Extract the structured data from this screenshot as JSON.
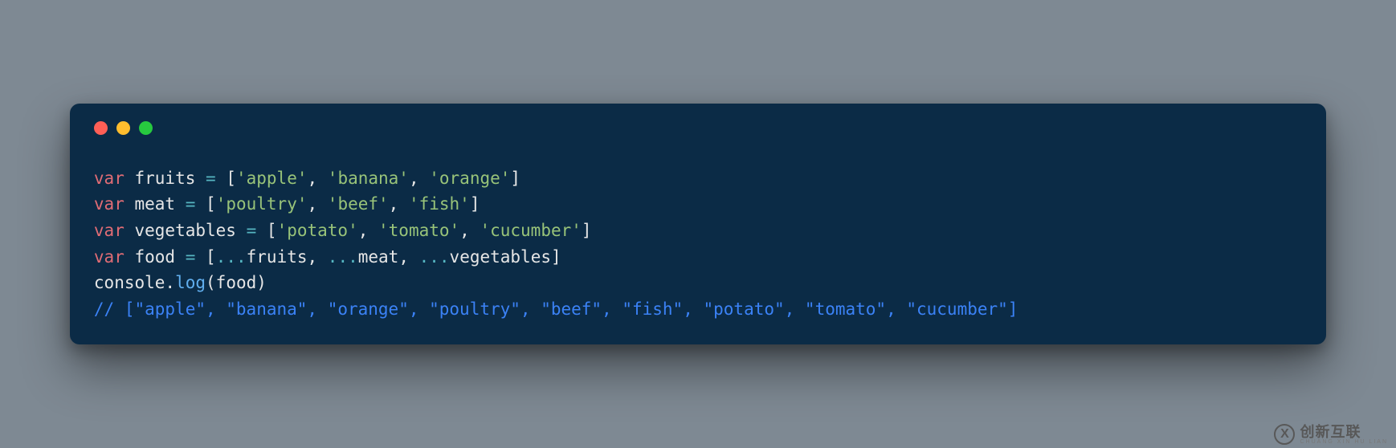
{
  "window": {
    "traffic_lights": {
      "red": "#ff5f56",
      "yellow": "#ffbd2e",
      "green": "#27c93f"
    }
  },
  "code": {
    "lines": [
      {
        "kw": "var",
        "id": "fruits",
        "eq": "=",
        "items": [
          "'apple'",
          "'banana'",
          "'orange'"
        ]
      },
      {
        "kw": "var",
        "id": "meat",
        "eq": "=",
        "items": [
          "'poultry'",
          "'beef'",
          "'fish'"
        ]
      },
      {
        "kw": "var",
        "id": "vegetables",
        "eq": "=",
        "items": [
          "'potato'",
          "'tomato'",
          "'cucumber'"
        ]
      }
    ],
    "concat_line": {
      "kw": "var",
      "id": "food",
      "eq": "=",
      "spreads": [
        "fruits",
        "meat",
        "vegetables"
      ]
    },
    "log_line": {
      "obj": "console",
      "method": "log",
      "arg": "food"
    },
    "comment": "// [\"apple\", \"banana\", \"orange\", \"poultry\", \"beef\", \"fish\", \"potato\", \"tomato\", \"cucumber\"]"
  },
  "watermark": {
    "icon_letter": "X",
    "main": "创新互联",
    "sub": "CHUANG XIN HU LIAN"
  }
}
